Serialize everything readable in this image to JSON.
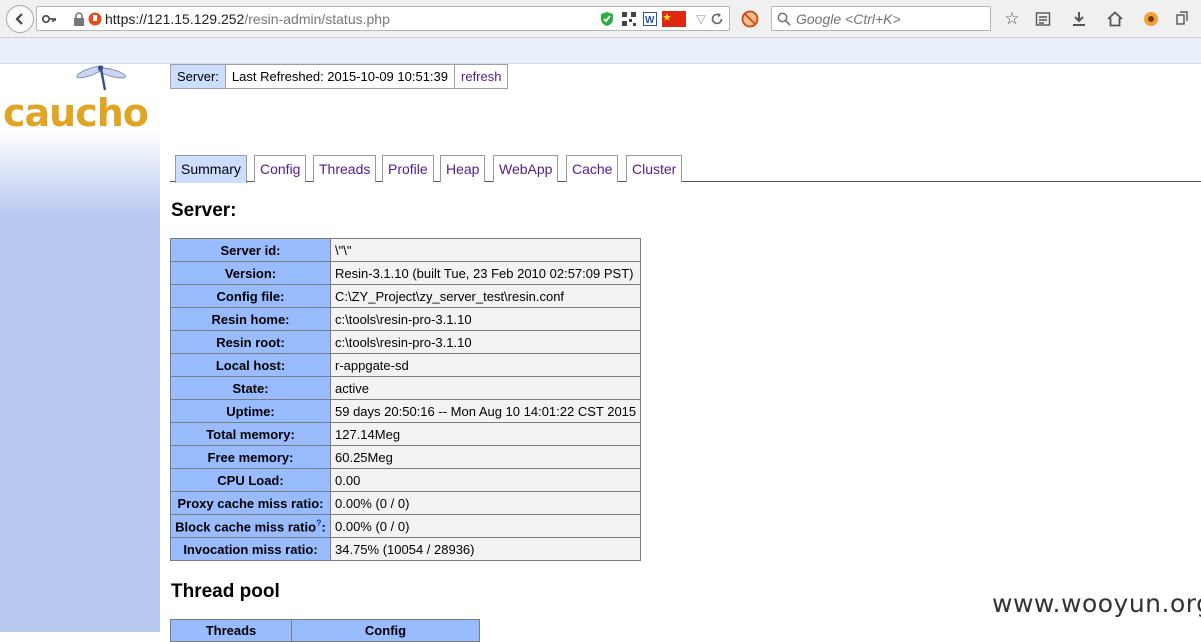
{
  "browser": {
    "url_host": "https://121.15.129.252",
    "url_path": "/resin-admin/status.php",
    "search_placeholder": "Google <Ctrl+K>"
  },
  "logo": {
    "text": "caucho"
  },
  "server_bar": {
    "label": "Server:",
    "last_refreshed": "Last Refreshed: 2015-10-09 10:51:39",
    "refresh_link": "refresh"
  },
  "tabs": [
    {
      "label": "Summary",
      "active": true
    },
    {
      "label": "Config"
    },
    {
      "label": "Threads"
    },
    {
      "label": "Profile"
    },
    {
      "label": "Heap"
    },
    {
      "label": "WebApp"
    },
    {
      "label": "Cache"
    },
    {
      "label": "Cluster"
    }
  ],
  "server_section": {
    "heading": "Server:",
    "rows": [
      {
        "key": "Server id:",
        "value": "\\\"\\\""
      },
      {
        "key": "Version:",
        "value": "Resin-3.1.10 (built Tue, 23 Feb 2010 02:57:09 PST)"
      },
      {
        "key": "Config file:",
        "value": "C:\\ZY_Project\\zy_server_test\\resin.conf"
      },
      {
        "key": "Resin home:",
        "value": "c:\\tools\\resin-pro-3.1.10"
      },
      {
        "key": "Resin root:",
        "value": "c:\\tools\\resin-pro-3.1.10"
      },
      {
        "key": "Local host:",
        "value": "r-appgate-sd"
      },
      {
        "key": "State:",
        "value": "active"
      },
      {
        "key": "Uptime:",
        "value": "59 days 20:50:16 -- Mon Aug 10 14:01:22 CST 2015"
      },
      {
        "key": "Total memory:",
        "value": "127.14Meg"
      },
      {
        "key": "Free memory:",
        "value": "60.25Meg"
      },
      {
        "key": "CPU Load:",
        "value": "0.00"
      },
      {
        "key": "Proxy cache miss ratio:",
        "value": "0.00% (0 / 0)"
      },
      {
        "key": "Block cache miss ratio",
        "help": "?",
        "suffix": ":",
        "value": "0.00% (0 / 0)"
      },
      {
        "key": "Invocation miss ratio:",
        "value": "34.75% (10054 / 28936)"
      }
    ]
  },
  "thread_section": {
    "heading": "Thread pool",
    "headers": [
      "Threads",
      "Config"
    ]
  },
  "watermark": "www.wooyun.org",
  "colors": {
    "table_key_bg": "#99bbff",
    "table_value_bg": "#f3f3f3",
    "tab_active_bg": "#ccddff",
    "sidebar_bg": "#b9c9f0",
    "logo_color": "#e0a524",
    "link_color": "#551a8b"
  }
}
